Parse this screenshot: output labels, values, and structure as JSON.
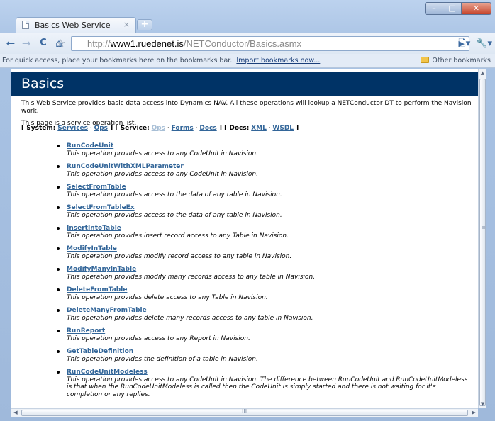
{
  "window": {
    "tab_title": "Basics Web Service",
    "tab_close": "×",
    "new_tab": "+",
    "minimize": "–",
    "maximize": "□",
    "close": "✕"
  },
  "toolbar": {
    "back": "←",
    "forward": "→",
    "reload": "C",
    "home": "⌂",
    "star": "☆",
    "url_scheme": "http://",
    "url_host": "www1.ruedenet.is",
    "url_path": "/NETConductor/Basics.asmx",
    "go": "▶",
    "page_menu": "🗋▾",
    "tools_menu": "🔧▾"
  },
  "bookmarks_bar": {
    "hint": "For quick access, place your bookmarks here on the bookmarks bar.",
    "import_link": "Import bookmarks now...",
    "other": "Other bookmarks"
  },
  "page": {
    "heading": "Basics",
    "description": "This Web Service provides basic data access into Dynamics NAV. All these operations will lookup a NETConductor DT to perform the Navision work.",
    "list_note": "This page is a service operation list.",
    "links": {
      "bracket_open": "[ ",
      "system_label": "System:",
      "services": "Services",
      "sep": " · ",
      "ops": "Ops",
      "bracket_mid": " ] [ ",
      "service_label": "Service:",
      "svc_ops": "Ops",
      "forms": "Forms",
      "docs": "Docs",
      "docs_label": "Docs:",
      "xml": "XML",
      "wsdl": "WSDL",
      "bracket_close": " ]"
    },
    "operations": [
      {
        "name": "RunCodeUnit",
        "description": "This operation provides access to any CodeUnit in Navision."
      },
      {
        "name": "RunCodeUnitWithXMLParameter",
        "description": "This operation provides access to any CodeUnit in Navision."
      },
      {
        "name": "SelectFromTable",
        "description": "This operation provides access to the data of any table in Navision."
      },
      {
        "name": "SelectFromTableEx",
        "description": "This operation provides access to the data of any table in Navision."
      },
      {
        "name": "InsertIntoTable",
        "description": "This operation provides insert record access to any Table in Navision."
      },
      {
        "name": "ModifyInTable",
        "description": "This operation provides modify record access to any table in Navision."
      },
      {
        "name": "ModifyManyInTable",
        "description": "This operation provides modify many records access to any table in Navision."
      },
      {
        "name": "DeleteFromTable",
        "description": "This operation provides delete access to any Table in Navision."
      },
      {
        "name": "DeleteManyFromTable",
        "description": "This operation provides delete many records access to any table in Navision."
      },
      {
        "name": "RunReport",
        "description": "This operation provides access to any Report in Navision."
      },
      {
        "name": "GetTableDefinition",
        "description": "This operation provides the definition of a table in Navision."
      },
      {
        "name": "RunCodeUnitModeless",
        "description": "This operation provides access to any CodeUnit in Navision. The difference between RunCodeUnit and RunCodeUnitModeless is that when the RunCodeUnitModeless is called then the CodeUnit is simply started and there is not waiting for it's completion or any replies."
      }
    ]
  },
  "scrollbars": {
    "up": "▲",
    "down": "▼",
    "left": "◀",
    "right": "▶",
    "v_grip": "≡",
    "h_grip": "III"
  }
}
